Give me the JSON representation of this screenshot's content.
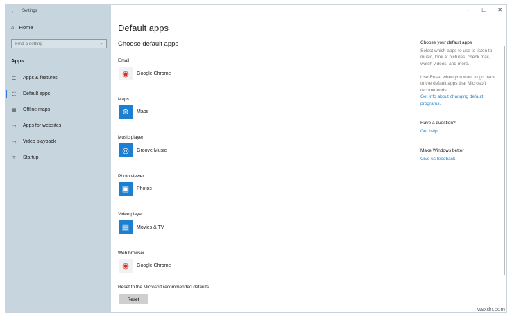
{
  "window": {
    "title": "Settings",
    "minimize": "–",
    "maximize": "☐",
    "close": "✕"
  },
  "sidebar": {
    "back": "←",
    "home": "Home",
    "search_placeholder": "Find a setting",
    "search_icon": "⌕",
    "section": "Apps",
    "items": [
      {
        "label": "Apps & features",
        "icon": "☰"
      },
      {
        "label": "Default apps",
        "icon": "☷"
      },
      {
        "label": "Offline maps",
        "icon": "▦"
      },
      {
        "label": "Apps for websites",
        "icon": "▭"
      },
      {
        "label": "Video playback",
        "icon": "▭"
      },
      {
        "label": "Startup",
        "icon": "⊤"
      }
    ]
  },
  "main": {
    "title": "Default apps",
    "subtitle": "Choose default apps",
    "categories": [
      {
        "label": "Email",
        "app": "Google Chrome",
        "color": "#f2f2f2"
      },
      {
        "label": "Maps",
        "app": "Maps",
        "color": "#1e7fd0"
      },
      {
        "label": "Music player",
        "app": "Groove Music",
        "color": "#1e7fd0"
      },
      {
        "label": "Photo viewer",
        "app": "Photos",
        "color": "#1e7fd0"
      },
      {
        "label": "Video player",
        "app": "Movies & TV",
        "color": "#1e7fd0"
      },
      {
        "label": "Web browser",
        "app": "Google Chrome",
        "color": "#f2f2f2"
      }
    ],
    "reset_label": "Reset to the Microsoft recommended defaults",
    "reset_button": "Reset"
  },
  "right": {
    "h1": "Choose your default apps",
    "p1": "Select which apps to use to listen to music, look at pictures, check mail, watch videos, and more.",
    "p2": "Use Reset when you want to go back to the default apps that Microsoft recommends.",
    "link1": "Get info about changing default programs.",
    "h2": "Have a question?",
    "link2": "Get help",
    "h3": "Make Windows better",
    "link3": "Give us feedback"
  },
  "watermark": "wsxdn.com"
}
